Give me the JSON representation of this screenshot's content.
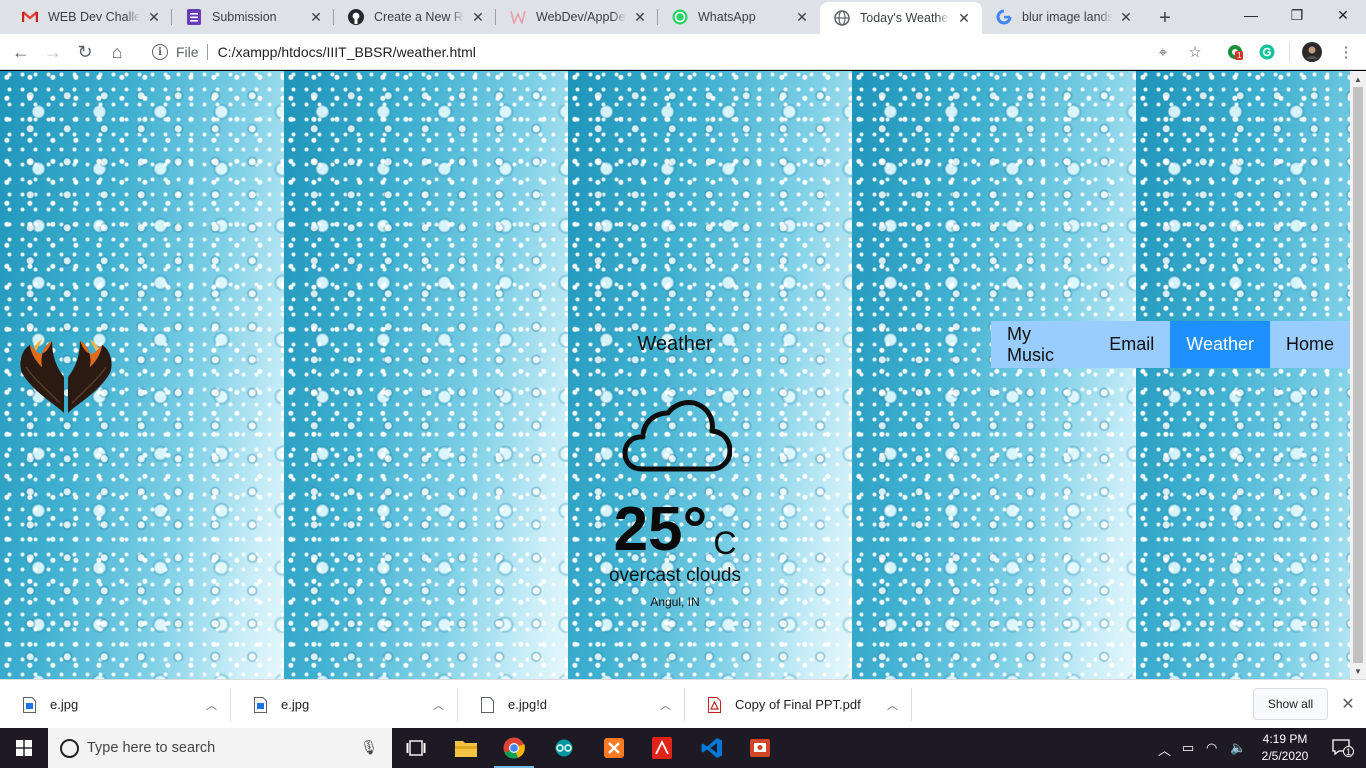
{
  "browser": {
    "tabs": [
      {
        "title": "WEB Dev Challenge",
        "icon": "gmail-icon",
        "active": false
      },
      {
        "title": "Submission",
        "icon": "forms-icon",
        "active": false
      },
      {
        "title": "Create a New Repo",
        "icon": "github-icon",
        "active": false
      },
      {
        "title": "WebDev/AppDev E",
        "icon": "webdev-icon",
        "active": false
      },
      {
        "title": "WhatsApp",
        "icon": "whatsapp-icon",
        "active": false
      },
      {
        "title": "Today's Weather",
        "icon": "globe-icon",
        "active": true
      },
      {
        "title": "blur image landsca",
        "icon": "google-icon",
        "active": false
      }
    ],
    "address": {
      "scheme": "File",
      "url": "C:/xampp/htdocs/IIIT_BBSR/weather.html"
    },
    "extension_badge": "1"
  },
  "page": {
    "weather": {
      "heading": "Weather",
      "temperature": "25°",
      "unit": "C",
      "condition": "overcast clouds",
      "location": "Angul, IN"
    },
    "nav": [
      {
        "label": "My Music",
        "active": false
      },
      {
        "label": "Email",
        "active": false
      },
      {
        "label": "Weather",
        "active": true
      },
      {
        "label": "Home",
        "active": false
      }
    ]
  },
  "downloads": {
    "items": [
      {
        "name": "e.jpg",
        "icon": "image-file-icon"
      },
      {
        "name": "e.jpg",
        "icon": "image-file-icon"
      },
      {
        "name": "e.jpg!d",
        "icon": "blank-file-icon"
      },
      {
        "name": "Copy of Final PPT.pdf",
        "icon": "pdf-file-icon"
      }
    ],
    "show_all": "Show all"
  },
  "taskbar": {
    "search_placeholder": "Type here to search",
    "time": "4:19 PM",
    "date": "2/5/2020",
    "notification_count": "1"
  },
  "colors": {
    "nav_bg": "#99ccff",
    "nav_active": "#1e90ff",
    "background": "#4fb3d0"
  }
}
